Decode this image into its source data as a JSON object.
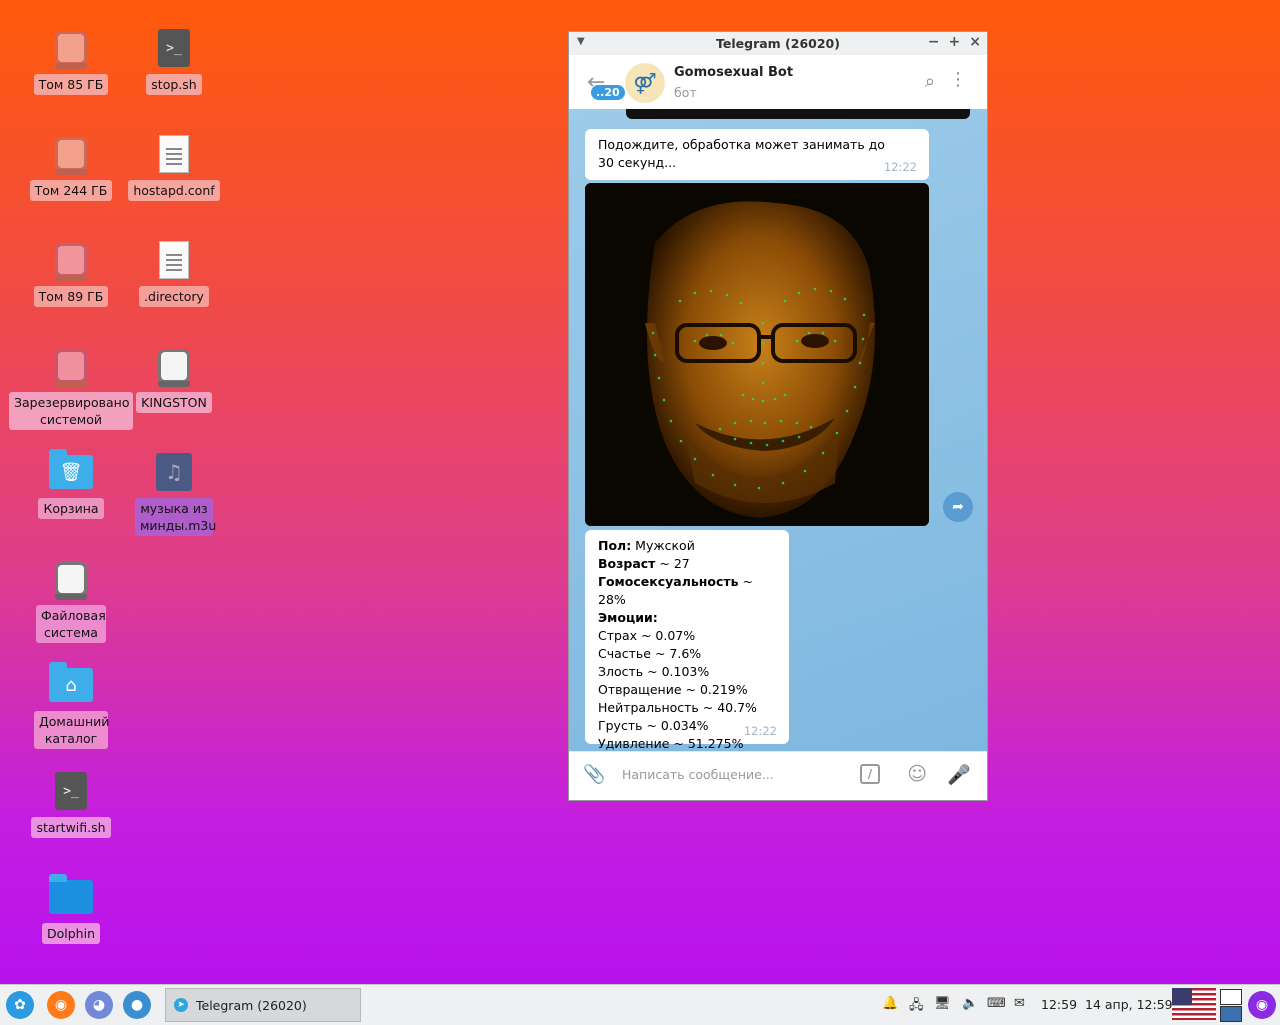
{
  "desktop": {
    "icons": [
      {
        "label": "Том 85 ГБ"
      },
      {
        "label": "stop.sh"
      },
      {
        "label": "Том 244 ГБ"
      },
      {
        "label": "hostapd.conf"
      },
      {
        "label": "Том 89 ГБ"
      },
      {
        "label": ".directory"
      },
      {
        "label": "Зарезервировано системой"
      },
      {
        "label": "KINGSTON"
      },
      {
        "label": "Корзина"
      },
      {
        "label": "музыка из минды.m3u"
      },
      {
        "label": "Файловая система"
      },
      {
        "label": "Домашний каталог"
      },
      {
        "label": "startwifi.sh"
      },
      {
        "label": "Dolphin"
      }
    ]
  },
  "window": {
    "title": "Telegram (26020)"
  },
  "chat": {
    "badge": "..20",
    "name": "Gomosexual Bot",
    "subtitle": "бот",
    "messages": {
      "wait_text": "Подождите, обработка может занимать до 30 секунд...",
      "wait_time": "12:22",
      "result_time": "12:22",
      "result_lines": [
        {
          "bold": "Пол:",
          "rest": " Мужской"
        },
        {
          "bold": "Возраст",
          "rest": " ~ 27"
        },
        {
          "bold": "Гомосексуальность",
          "rest": " ~ 28%"
        },
        {
          "bold": "Эмоции:",
          "rest": ""
        },
        {
          "bold": "",
          "rest": "Страх ~ 0.07%"
        },
        {
          "bold": "",
          "rest": "Счастье ~ 7.6%"
        },
        {
          "bold": "",
          "rest": "Злость ~ 0.103%"
        },
        {
          "bold": "",
          "rest": "Отвращение ~ 0.219%"
        },
        {
          "bold": "",
          "rest": "Нейтральность ~ 40.7%"
        },
        {
          "bold": "",
          "rest": "Грусть ~ 0.034%"
        },
        {
          "bold": "",
          "rest": "Удивление ~ 51.275%"
        }
      ]
    },
    "composer": {
      "placeholder": "Написать сообщение..."
    }
  },
  "taskbar": {
    "task_label": "Telegram (26020)",
    "time": "12:59",
    "datetime": "14 апр, 12:59"
  }
}
